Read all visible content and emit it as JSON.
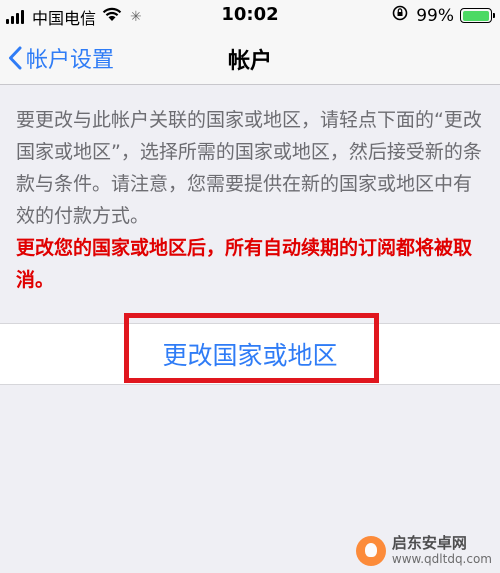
{
  "status_bar": {
    "carrier": "中国电信",
    "time": "10:02",
    "battery_percent": "99%",
    "battery_level": 0.99
  },
  "nav": {
    "back_label": "帐户设置",
    "title": "帐户"
  },
  "content": {
    "info_text": "要更改与此帐户关联的国家或地区，请轻点下面的“更改国家或地区”，选择所需的国家或地区，然后接受新的条款与条件。请注意，您需要提供在新的国家或地区中有效的付款方式。",
    "warning_text": "更改您的国家或地区后，所有自动续期的订阅都将被取消。",
    "action_label": "更改国家或地区"
  },
  "watermark": {
    "name": "启东安卓网",
    "url": "www.qdltdq.com"
  },
  "colors": {
    "accent": "#2f7cf6",
    "warning": "#e00000",
    "highlight": "#e0161e",
    "battery": "#4cd964"
  },
  "icons": [
    "signal-icon",
    "wifi-icon",
    "loading-icon",
    "orientation-lock-icon",
    "battery-icon",
    "chevron-left-icon",
    "watermark-logo-icon"
  ]
}
